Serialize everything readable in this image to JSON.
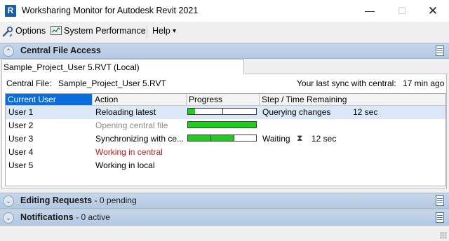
{
  "window": {
    "title": "Worksharing Monitor for Autodesk Revit 2021",
    "app_icon_letter": "R",
    "minimize_glyph": "—",
    "maximize_glyph": "☐",
    "close_glyph": "✕"
  },
  "menu": {
    "options": "Options",
    "system_performance": "System Performance",
    "help": "Help",
    "help_arrow": "▾"
  },
  "central_file_access": {
    "title": "Central File Access",
    "tab_label": "Sample_Project_User 5.RVT (Local)",
    "central_file_label": "Central File:",
    "central_file_value": "Sample_Project_User 5.RVT",
    "last_sync_label": "Your last sync with central:",
    "last_sync_value": "17 min ago",
    "columns": [
      "Current User",
      "Action",
      "Progress",
      "Step / Time Remaining"
    ],
    "rows": [
      {
        "user": "User 1",
        "action": "Reloading latest",
        "action_style": "normal",
        "progress": 0.1,
        "ticks": [
          0.5
        ],
        "step": "Querying changes",
        "time": "12 sec",
        "selected": true
      },
      {
        "user": "User 2",
        "action": "Opening central file",
        "action_style": "gray",
        "progress": 1.0,
        "ticks": [],
        "step": "",
        "time": "",
        "selected": false
      },
      {
        "user": "User 3",
        "action": "Synchronizing with ce...",
        "action_style": "normal",
        "progress": 0.67,
        "ticks": [
          0.33,
          0.67
        ],
        "step": "Waiting",
        "time": "12 sec",
        "selected": false
      },
      {
        "user": "User 4",
        "action": "Working in central",
        "action_style": "red",
        "progress": null,
        "ticks": [],
        "step": "",
        "time": "",
        "selected": false
      },
      {
        "user": "User 5",
        "action": "Working in local",
        "action_style": "normal",
        "progress": null,
        "ticks": [],
        "step": "",
        "time": "",
        "selected": false
      }
    ]
  },
  "editing_requests": {
    "title": "Editing Requests",
    "subtitle": "- 0 pending"
  },
  "notifications": {
    "title": "Notifications",
    "subtitle": "- 0 active"
  },
  "icons": {
    "collapse": "⌃",
    "expand": "⌄",
    "hourglass": "⧗"
  },
  "colors": {
    "accent_blue": "#0a6dd9",
    "progress_green": "#1fcc1f",
    "header_blue": "#b3c8e2",
    "warning_red": "#b21c1c"
  }
}
